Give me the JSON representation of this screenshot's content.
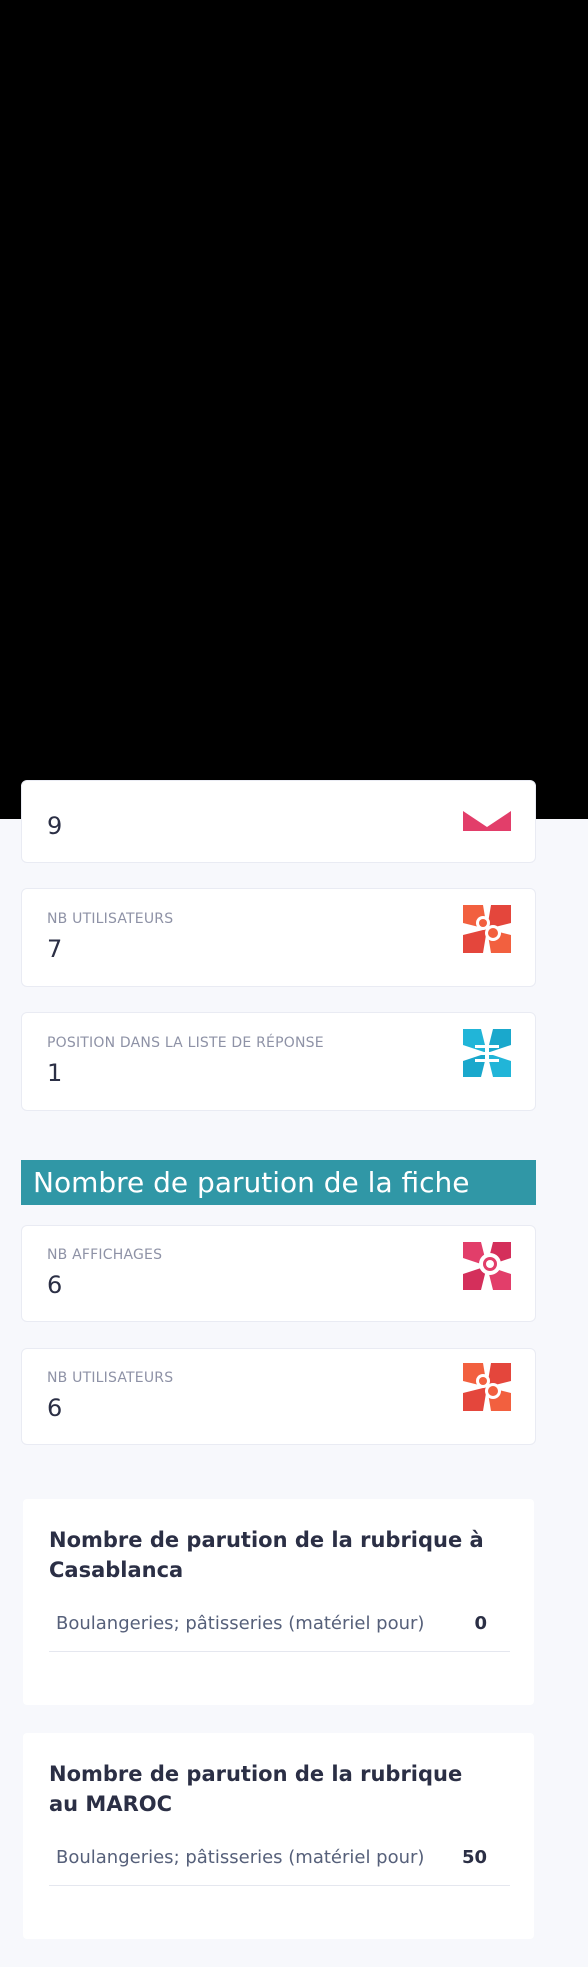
{
  "cards_top": [
    {
      "label": "",
      "value": "9",
      "icon": "pink-icon"
    },
    {
      "label": "NB UTILISATEURS",
      "value": "7",
      "icon": "users-icon"
    },
    {
      "label": "POSITION DANS LA LISTE DE RÉPONSE",
      "value": "1",
      "icon": "list-position-icon"
    }
  ],
  "section": {
    "title": "Nombre de parution de la fiche"
  },
  "cards_fiche": [
    {
      "label": "NB AFFICHAGES",
      "value": "6",
      "icon": "eye-icon"
    },
    {
      "label": "NB UTILISATEURS",
      "value": "6",
      "icon": "users-icon"
    }
  ],
  "panel_casablanca": {
    "title": "Nombre de parution de la rubrique à Casablanca",
    "row_label": "Boulangeries; pâtisseries (matériel pour)",
    "row_value": "0"
  },
  "panel_maroc": {
    "title": "Nombre de parution de la rubrique au MAROC",
    "row_label": "Boulangeries; pâtisseries (matériel pour)",
    "row_value": "50"
  },
  "colors": {
    "header": "#3097a6",
    "pink": "#e23e6a",
    "orange": "#f2603f",
    "cyan": "#21b5d8"
  }
}
